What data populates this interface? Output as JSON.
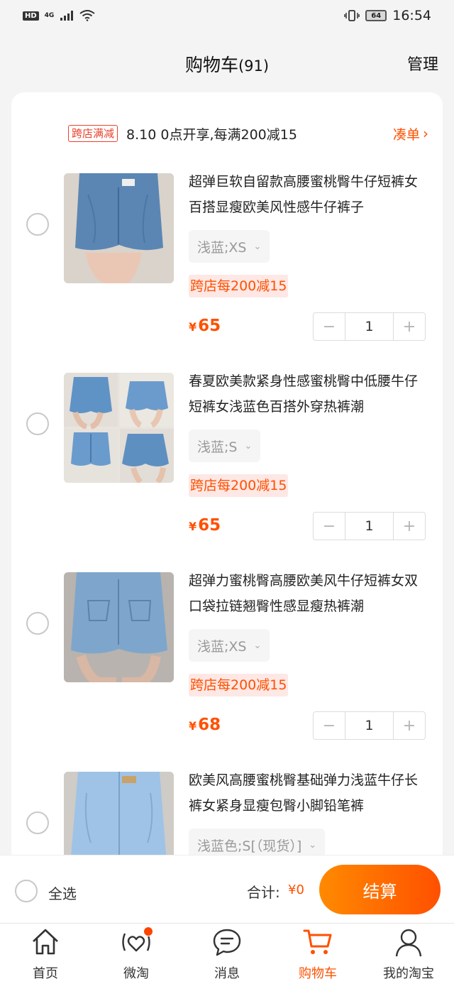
{
  "status_bar": {
    "hd": "HD",
    "network": "4G",
    "battery": "64",
    "time": "16:54"
  },
  "header": {
    "title": "购物车",
    "count": "(91)",
    "manage": "管理"
  },
  "promo": {
    "tag": "跨店满减",
    "text": "8.10  0点开享,每满200减15",
    "collect": "凑单",
    "collect_arrow": "›"
  },
  "items": [
    {
      "title": "超弹巨软自留款高腰蜜桃臀牛仔短裤女百搭显瘦欧美风性感牛仔裤子",
      "sku": "浅蓝;XS",
      "discount": "跨店每200减15",
      "currency": "¥",
      "price": "65",
      "qty": "1"
    },
    {
      "title": "春夏欧美款紧身性感蜜桃臀中低腰牛仔短裤女浅蓝色百搭外穿热裤潮",
      "sku": "浅蓝;S",
      "discount": "跨店每200减15",
      "currency": "¥",
      "price": "65",
      "qty": "1"
    },
    {
      "title": "超弹力蜜桃臀高腰欧美风牛仔短裤女双口袋拉链翘臀性感显瘦热裤潮",
      "sku": "浅蓝;XS",
      "discount": "跨店每200减15",
      "currency": "¥",
      "price": "68",
      "qty": "1"
    },
    {
      "title": "欧美风高腰蜜桃臀基础弹力浅蓝牛仔长裤女紧身显瘦包臀小脚铅笔裤",
      "sku": "浅蓝色;S[（现货）]"
    }
  ],
  "stepper": {
    "minus": "−",
    "plus": "+"
  },
  "footer": {
    "select_all": "全选",
    "total_label": "合计:",
    "total_value": "¥0",
    "checkout": "结算"
  },
  "tabs": [
    {
      "label": "首页",
      "icon": "home-icon"
    },
    {
      "label": "微淘",
      "icon": "heart-signal-icon"
    },
    {
      "label": "消息",
      "icon": "chat-bubble-icon"
    },
    {
      "label": "购物车",
      "icon": "cart-icon"
    },
    {
      "label": "我的淘宝",
      "icon": "user-icon"
    }
  ],
  "colors": {
    "accent": "#ff5000",
    "promo_red": "#e8432e",
    "discount_bg": "#fde8e5"
  }
}
